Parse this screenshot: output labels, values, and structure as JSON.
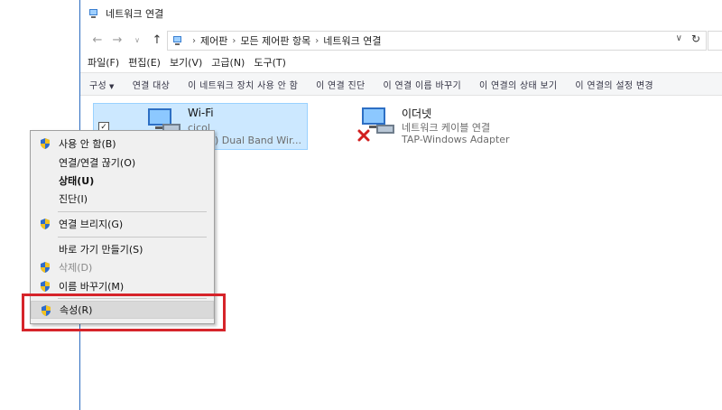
{
  "window": {
    "title": "네트워크 연결"
  },
  "address": {
    "breadcrumbs": [
      "제어판",
      "모든 제어판 항목",
      "네트워크 연결"
    ],
    "separator": "›",
    "dropdown_glyph": "∨",
    "refresh_glyph": "↻"
  },
  "nav": {
    "back": "←",
    "forward": "→",
    "recent": "∨",
    "up": "↑"
  },
  "menubar": [
    "파일(F)",
    "편집(E)",
    "보기(V)",
    "고급(N)",
    "도구(T)"
  ],
  "commands": [
    "구성",
    "연결 대상",
    "이 네트워크 장치 사용 안 함",
    "이 연결 진단",
    "이 연결 이름 바꾸기",
    "이 연결의 상태 보기",
    "이 연결의 설정 변경"
  ],
  "connections": [
    {
      "name": "Wi-Fi",
      "status": "cicol",
      "adapter": ") Dual Band Wir...",
      "selected": true,
      "checkbox_mark": "✓"
    },
    {
      "name": "이더넷",
      "status": "네트워크 케이블 연결",
      "adapter": "TAP-Windows Adapter",
      "selected": false
    }
  ],
  "context_menu": {
    "items": [
      {
        "label": "사용 안 함(B)",
        "shield": true
      },
      {
        "label": "연결/연결 끊기(O)",
        "shield": false
      },
      {
        "label": "상태(U)",
        "shield": false,
        "bold": true
      },
      {
        "label": "진단(I)",
        "shield": false
      },
      {
        "label": "연결 브리지(G)",
        "shield": true
      },
      {
        "label": "바로 가기 만들기(S)",
        "shield": false
      },
      {
        "label": "삭제(D)",
        "shield": true,
        "disabled": true
      },
      {
        "label": "이름 바꾸기(M)",
        "shield": true
      },
      {
        "label": "속성(R)",
        "shield": true,
        "hovered": true
      }
    ]
  },
  "colors": {
    "selection_fill": "#cce8ff",
    "selection_border": "#99d1ff",
    "annotation_red": "#d6242a",
    "window_border": "#2b6bbf"
  },
  "icons": [
    "network-connections-icon",
    "wifi-adapter-icon",
    "ethernet-adapter-icon",
    "disconnected-x-icon",
    "uac-shield-icon",
    "refresh-icon"
  ]
}
